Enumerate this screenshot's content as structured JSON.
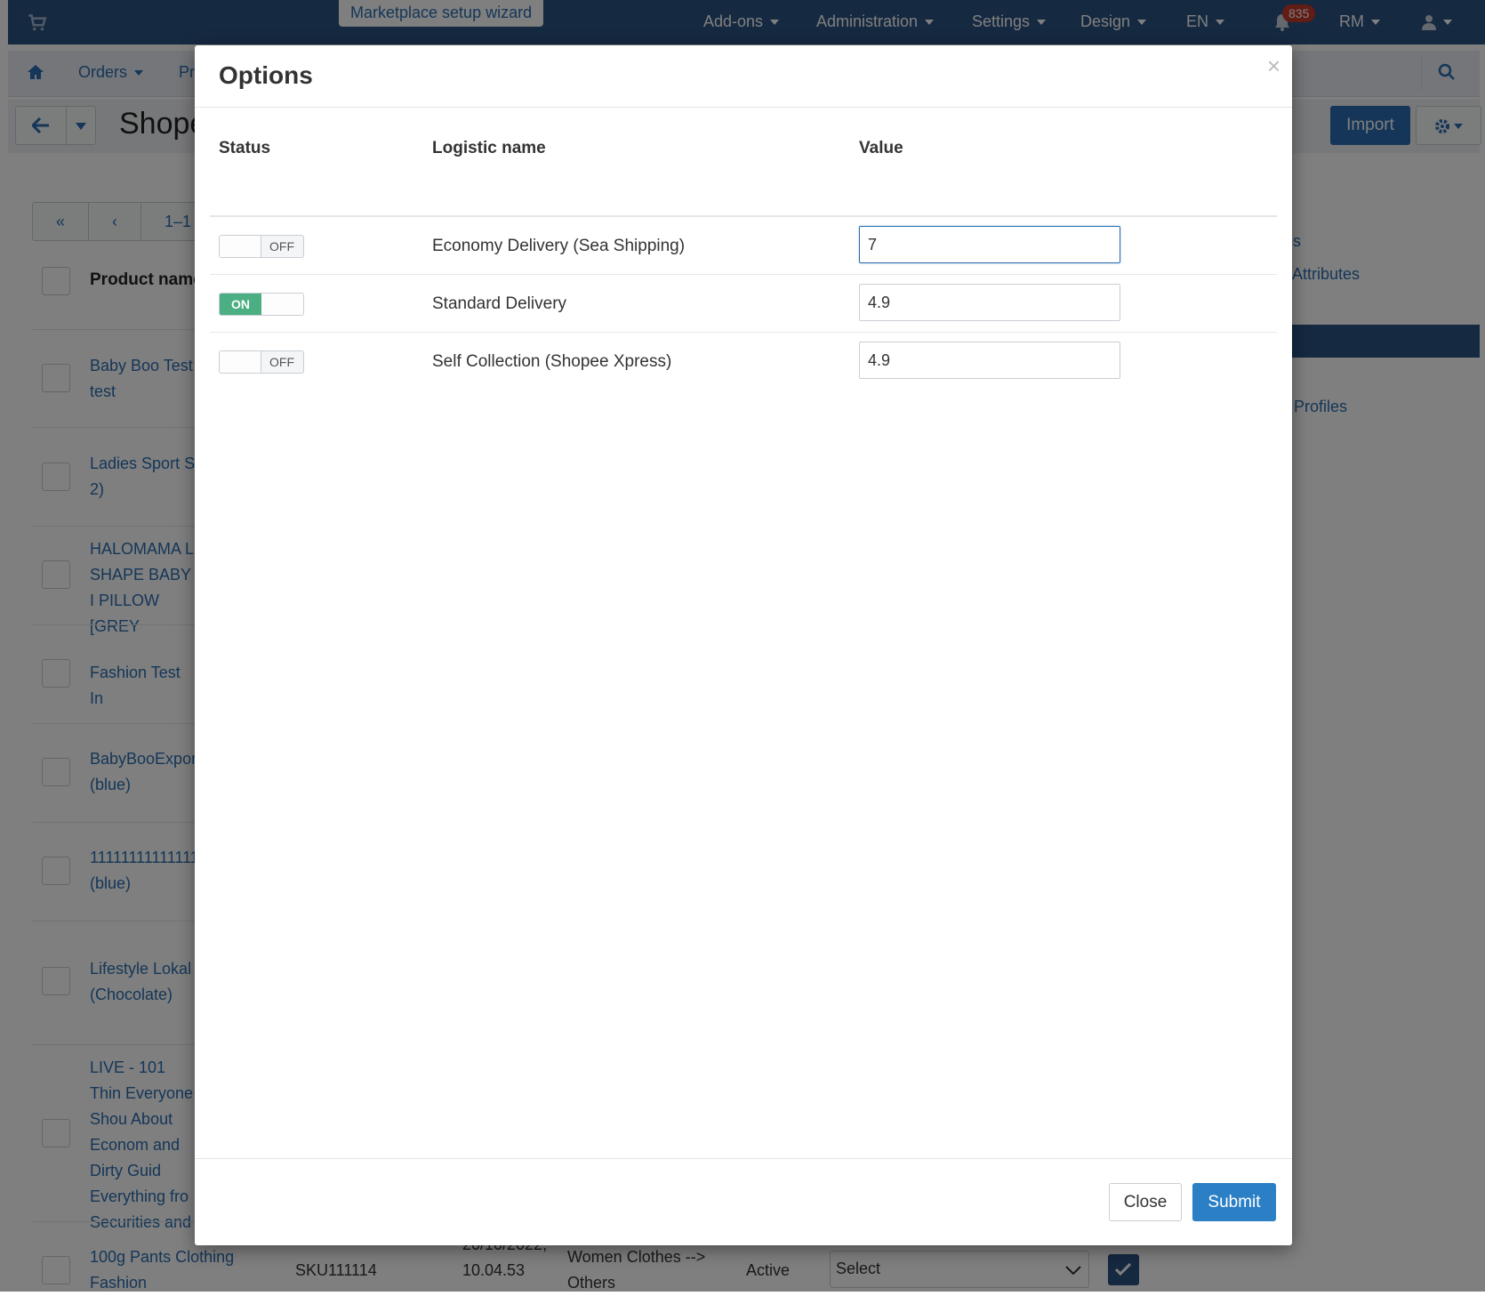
{
  "topnav": {
    "wizard_label": "Marketplace setup wizard",
    "items": [
      "Add-ons",
      "Administration",
      "Settings",
      "Design",
      "EN"
    ],
    "notification_count": "835",
    "currency": "RM"
  },
  "subnav": {
    "orders": "Orders",
    "products_partial": "Pr"
  },
  "page": {
    "title_partial": "Shopee",
    "import_label": "Import"
  },
  "background": {
    "pager_range": "1–1",
    "column_product_name": "Product name",
    "products": [
      "Baby Boo Test test",
      "Ladies Sport S 2)",
      "HALOMAMA L SHAPE BABY I PILLOW [GREY",
      "Fashion Test In",
      "BabyBooExpor (blue)",
      "11111111111111 (blue)",
      "Lifestyle Lokal (Chocolate)",
      "LIVE - 101 Thin Everyone Shou About Econom and Dirty Guid Everything fro Securities and",
      "100g Pants Clothing Fashion"
    ],
    "last_row": {
      "sku": "SKU111114",
      "date": "20/10/2022, 10.04.53",
      "category": "Women Clothes --> Others",
      "status": "Active",
      "select_placeholder": "Select"
    },
    "side_links": [
      "ies",
      "y Attributes",
      "s",
      "s",
      "Profiles"
    ]
  },
  "modal": {
    "title": "Options",
    "close_symbol": "×",
    "columns": {
      "status": "Status",
      "logistic_name": "Logistic name",
      "value": "Value"
    },
    "rows": [
      {
        "status": "OFF",
        "name": "Economy Delivery (Sea Shipping)",
        "value": "7"
      },
      {
        "status": "ON",
        "name": "Standard Delivery",
        "value": "4.9"
      },
      {
        "status": "OFF",
        "name": "Self Collection (Shopee Xpress)",
        "value": "4.9"
      }
    ],
    "close_label": "Close",
    "submit_label": "Submit"
  },
  "colors": {
    "nav_bg": "#2a5382",
    "accent": "#2a6db0",
    "toggle_on": "#4caf83",
    "submit": "#2a7fc5"
  }
}
